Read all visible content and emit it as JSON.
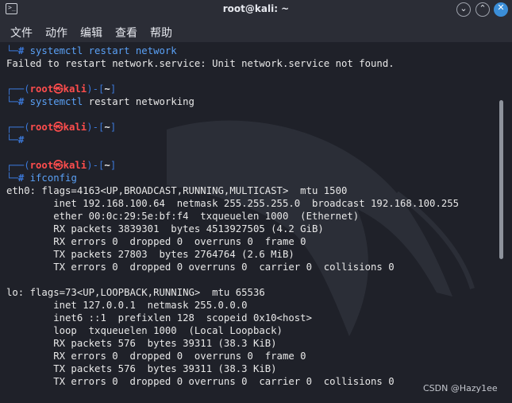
{
  "window": {
    "title": "root@kali: ~",
    "icon": "terminal-icon",
    "controls": {
      "minimize": "⌄",
      "maximize": "⌃",
      "close": "✕"
    }
  },
  "menu": {
    "file": "文件",
    "action": "动作",
    "edit": "编辑",
    "view": "查看",
    "help": "帮助"
  },
  "prompt": {
    "open": "(",
    "user": "root",
    "at": "㉿",
    "host": "kali",
    "mid": ")-[",
    "dir": "~",
    "close": "]",
    "top_corner": "┌──",
    "bottom_corner": "└─",
    "hash": "# "
  },
  "terminal": {
    "cmd1": "systemctl restart network",
    "out1": "Failed to restart network.service: Unit network.service not found.",
    "cmd2_a": "systemctl",
    "cmd2_b": " restart networking",
    "cmd4": "ifconfig",
    "output": [
      "eth0: flags=4163<UP,BROADCAST,RUNNING,MULTICAST>  mtu 1500",
      "        inet 192.168.100.64  netmask 255.255.255.0  broadcast 192.168.100.255",
      "        ether 00:0c:29:5e:bf:f4  txqueuelen 1000  (Ethernet)",
      "        RX packets 3839301  bytes 4513927505 (4.2 GiB)",
      "        RX errors 0  dropped 0  overruns 0  frame 0",
      "        TX packets 27803  bytes 2764764 (2.6 MiB)",
      "        TX errors 0  dropped 0 overruns 0  carrier 0  collisions 0",
      "",
      "lo: flags=73<UP,LOOPBACK,RUNNING>  mtu 65536",
      "        inet 127.0.0.1  netmask 255.0.0.0",
      "        inet6 ::1  prefixlen 128  scopeid 0x10<host>",
      "        loop  txqueuelen 1000  (Local Loopback)",
      "        RX packets 576  bytes 39311 (38.3 KiB)",
      "        RX errors 0  dropped 0  overruns 0  frame 0",
      "        TX packets 576  bytes 39311 (38.3 KiB)",
      "        TX errors 0  dropped 0 overruns 0  carrier 0  collisions 0"
    ]
  },
  "watermark": "CSDN @Hazy1ee",
  "colors": {
    "background": "#1f2129",
    "prompt_frame": "#3b78d8",
    "user_host": "#ff4d4d",
    "command": "#5aa0f5",
    "close_button": "#3b8ed8"
  }
}
